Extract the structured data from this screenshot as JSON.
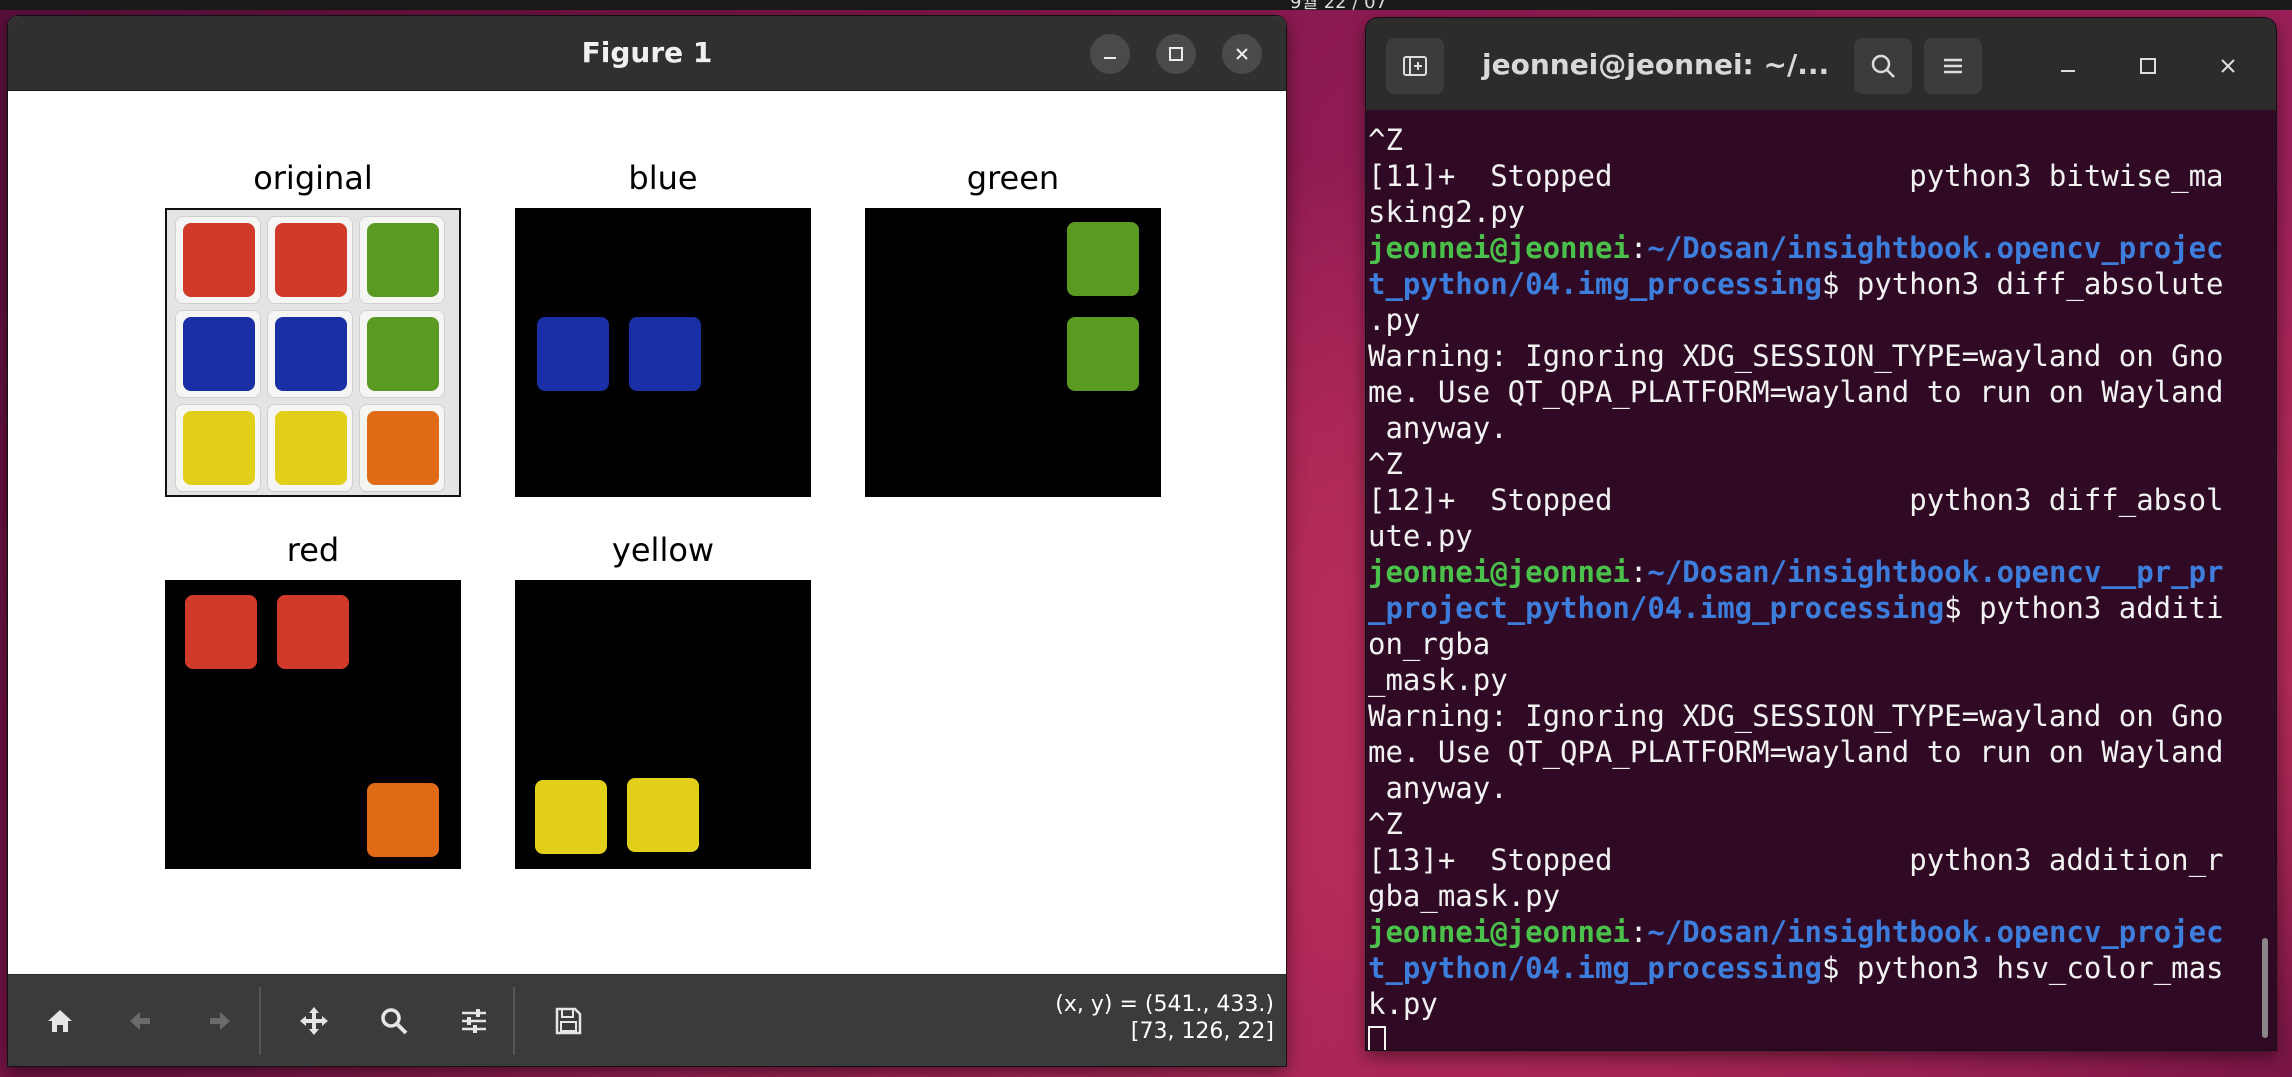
{
  "desktop": {
    "clock": "9월 22 / 07"
  },
  "figure": {
    "title": "Figure 1",
    "subplots": {
      "original": "original",
      "blue": "blue",
      "green": "green",
      "red": "red",
      "yellow": "yellow"
    },
    "status": {
      "coords": "(x, y) = (541., 433.)",
      "pixel": "[73, 126, 22]"
    },
    "toolbar": [
      "home-icon",
      "back-icon",
      "forward-icon",
      "pan-icon",
      "zoom-icon",
      "configure-icon",
      "save-icon"
    ],
    "colors": {
      "red": "#cf3a2b",
      "blue": "#1a2fa6",
      "green": "#5b9a22",
      "yellow": "#e2cf1a",
      "orange": "#e06a16"
    }
  },
  "terminal": {
    "title": "jeonnei@jeonnei: ~/...",
    "lines": [
      {
        "t": "^Z"
      },
      {
        "t": "[11]+  Stopped                 python3 bitwise_ma"
      },
      {
        "t": "sking2.py"
      },
      {
        "user": "jeonnei@jeonnei",
        "sep": ":",
        "path": "~/Dosan/insightbook.opencv_projec",
        "rest": ""
      },
      {
        "path": "t_python/04.img_processing",
        "rest": "$ python3 diff_absolute"
      },
      {
        "t": ".py"
      },
      {
        "t": "Warning: Ignoring XDG_SESSION_TYPE=wayland on Gno"
      },
      {
        "t": "me. Use QT_QPA_PLATFORM=wayland to run on Wayland"
      },
      {
        "t": " anyway."
      },
      {
        "t": "^Z"
      },
      {
        "t": "[12]+  Stopped                 python3 diff_absol"
      },
      {
        "t": "ute.py"
      },
      {
        "user": "jeonnei@jeonnei",
        "sep": ":",
        "path": "~/Dosan/insightbook.opencv__pr_pr",
        "rest": ""
      },
      {
        "path": "_project_python/04.img_processing",
        "rest": "$ python3 additi"
      },
      {
        "t": "on_rgba"
      },
      {
        "t": "_mask.py"
      },
      {
        "t": "Warning: Ignoring XDG_SESSION_TYPE=wayland on Gno"
      },
      {
        "t": "me. Use QT_QPA_PLATFORM=wayland to run on Wayland"
      },
      {
        "t": " anyway."
      },
      {
        "t": "^Z"
      },
      {
        "t": "[13]+  Stopped                 python3 addition_r"
      },
      {
        "t": "gba_mask.py"
      },
      {
        "user": "jeonnei@jeonnei",
        "sep": ":",
        "path": "~/Dosan/insightbook.opencv_projec",
        "rest": ""
      },
      {
        "path": "t_python/04.img_processing",
        "rest": "$ python3 hsv_color_mas"
      },
      {
        "t": "k.py"
      }
    ]
  }
}
